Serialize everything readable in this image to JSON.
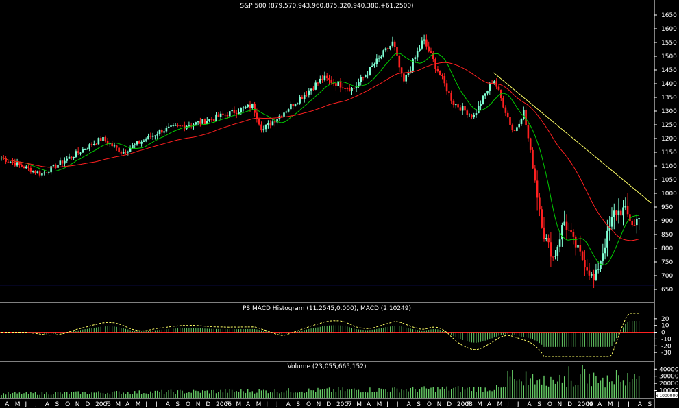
{
  "chart_data": [
    {
      "type": "candlestick",
      "title": "S&P 500 (879.570,943.960,875.320,940.380,+61.2500)",
      "ylim": [
        610,
        1670
      ],
      "y_ticks": [
        650,
        700,
        750,
        800,
        850,
        900,
        950,
        1000,
        1050,
        1100,
        1150,
        1200,
        1250,
        1300,
        1350,
        1400,
        1450,
        1500,
        1550,
        1600,
        1650
      ],
      "horizontal_line": {
        "value": 666,
        "color": "#2b2bff"
      },
      "colors": {
        "up": "#7fffd4",
        "down": "#ff2020",
        "ma_short": "#00cc00",
        "ma_long": "#ff2020",
        "trendline": "#ffff66"
      },
      "key_points": [
        {
          "date": "2004-04",
          "value": 1130
        },
        {
          "date": "2004-08",
          "value": 1070
        },
        {
          "date": "2005-02",
          "value": 1200
        },
        {
          "date": "2005-04",
          "value": 1150
        },
        {
          "date": "2005-08",
          "value": 1230
        },
        {
          "date": "2005-12",
          "value": 1260
        },
        {
          "date": "2006-05",
          "value": 1320
        },
        {
          "date": "2006-06",
          "value": 1230
        },
        {
          "date": "2006-12",
          "value": 1420
        },
        {
          "date": "2007-03",
          "value": 1380
        },
        {
          "date": "2007-07",
          "value": 1550
        },
        {
          "date": "2007-08",
          "value": 1400
        },
        {
          "date": "2007-10",
          "value": 1560
        },
        {
          "date": "2008-01",
          "value": 1330
        },
        {
          "date": "2008-03",
          "value": 1280
        },
        {
          "date": "2008-05",
          "value": 1420
        },
        {
          "date": "2008-07",
          "value": 1220
        },
        {
          "date": "2008-08",
          "value": 1300
        },
        {
          "date": "2008-10",
          "value": 850
        },
        {
          "date": "2008-11",
          "value": 760
        },
        {
          "date": "2008-12",
          "value": 900
        },
        {
          "date": "2009-01",
          "value": 820
        },
        {
          "date": "2009-03",
          "value": 680
        },
        {
          "date": "2009-05",
          "value": 930
        },
        {
          "date": "2009-06",
          "value": 940
        },
        {
          "date": "2009-07",
          "value": 880
        },
        {
          "date": "2009-07b",
          "value": 940
        }
      ],
      "trendline": {
        "start": {
          "date": "2008-05",
          "value": 1440
        },
        "end": {
          "date": "2009-08",
          "value": 965
        }
      }
    },
    {
      "type": "histogram",
      "title": "PS MACD Histogram (11.2545,0.000), MACD (2.10249)",
      "ylim": [
        -38,
        30
      ],
      "y_ticks": [
        20,
        10,
        0,
        -10,
        -20,
        -30
      ]
    },
    {
      "type": "bar",
      "title": "Volume (23,055,665,152)",
      "y_ticks": [
        40000,
        30000,
        20000,
        10000
      ],
      "unit_label": "x 1000000"
    }
  ],
  "x_axis": {
    "labels": [
      "A",
      "M",
      "J",
      "J",
      "A",
      "S",
      "O",
      "N",
      "D",
      "2005",
      "F",
      "M",
      "A",
      "M",
      "J",
      "J",
      "A",
      "S",
      "O",
      "N",
      "D",
      "2006",
      "F",
      "M",
      "A",
      "M",
      "J",
      "J",
      "A",
      "S",
      "O",
      "N",
      "D",
      "2007",
      "F",
      "M",
      "A",
      "M",
      "J",
      "J",
      "A",
      "S",
      "O",
      "N",
      "D",
      "2008",
      "F",
      "M",
      "A",
      "M",
      "J",
      "J",
      "A",
      "S",
      "O",
      "N",
      "D",
      "2009",
      "M",
      "A",
      "M",
      "J",
      "J",
      "A",
      "S"
    ]
  }
}
